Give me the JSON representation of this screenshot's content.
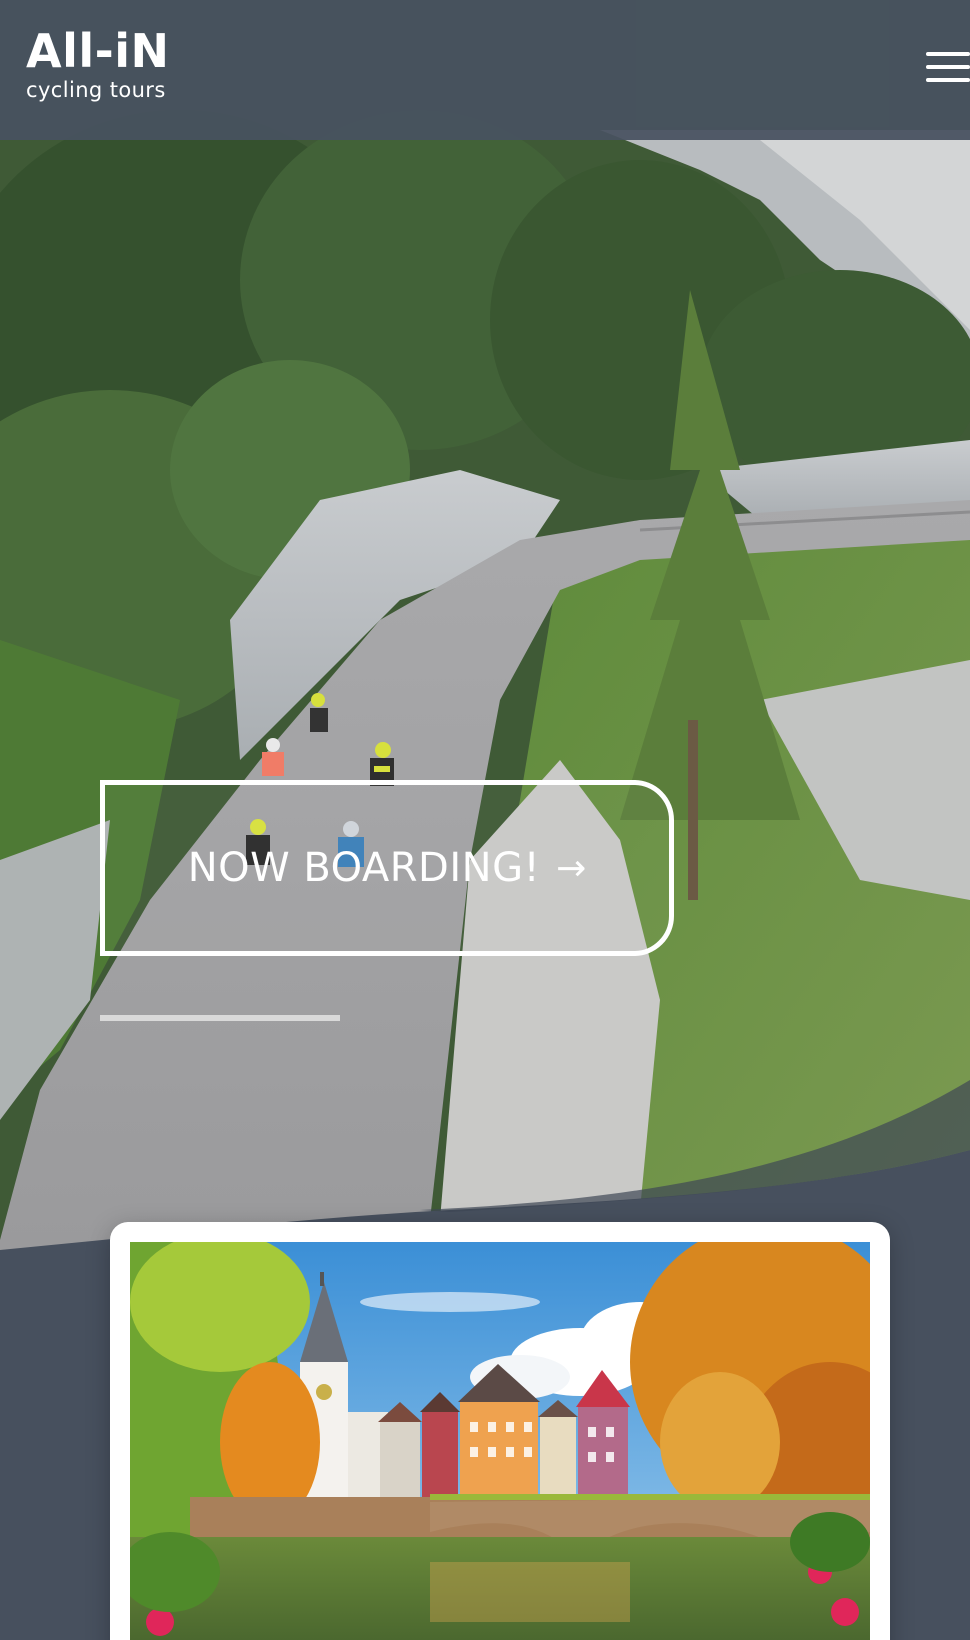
{
  "header": {
    "logo_title": "All-iN",
    "logo_subtitle": "cycling tours",
    "menu_icon": "hamburger-menu-icon"
  },
  "hero": {
    "cta_label": "NOW BOARDING!",
    "cta_arrow": "→",
    "cta_icon": "arrow-right-icon"
  },
  "card": {
    "image_icon": "town-bridge-photo"
  },
  "colors": {
    "header_bg": "#485260",
    "page_bg": "#47505e",
    "card_bg": "#ffffff",
    "text": "#ffffff"
  }
}
